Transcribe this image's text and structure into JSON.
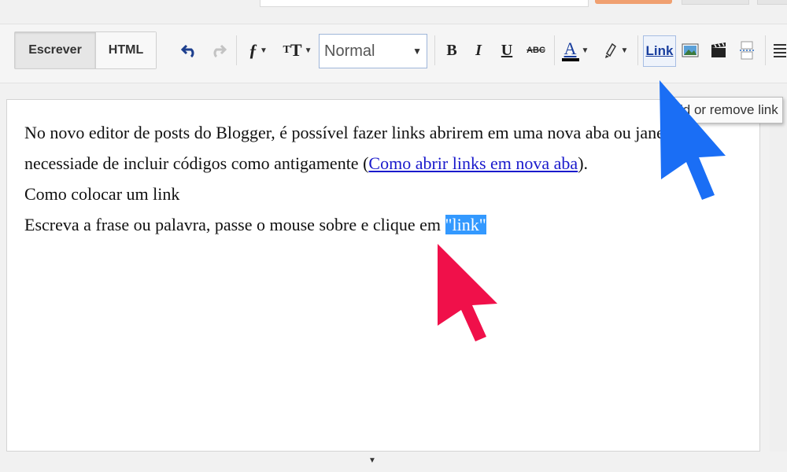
{
  "modes": {
    "compose": "Escrever",
    "html": "HTML"
  },
  "toolbar": {
    "format_select_value": "Normal",
    "bold": "B",
    "italic": "I",
    "underline": "U",
    "strikethrough": "ABC",
    "font_color": "A",
    "link": "Link"
  },
  "tooltip": {
    "text": "ld or remove link"
  },
  "editor": {
    "line1": "No novo editor de posts do Blogger, é possível fazer links abrirem em uma nova aba ou janela, se",
    "line2_before": "necessiade de incluir códigos como antigamente (",
    "line2_link": "Como abrir links em nova aba",
    "line2_after": ").",
    "line3": "Como colocar um link",
    "line4_before": "Escreva a frase ou palavra, passe o mouse sobre e clique em ",
    "line4_selected": "\"link\""
  },
  "colors": {
    "blue_arrow": "#1a6ef5",
    "red_arrow": "#f0104a",
    "selection": "#3399ff"
  },
  "icons": [
    "undo-icon",
    "redo-icon",
    "font-family-icon",
    "font-size-icon",
    "text-color-icon",
    "highlight-icon",
    "image-icon",
    "video-icon",
    "jump-break-icon",
    "align-icon"
  ]
}
